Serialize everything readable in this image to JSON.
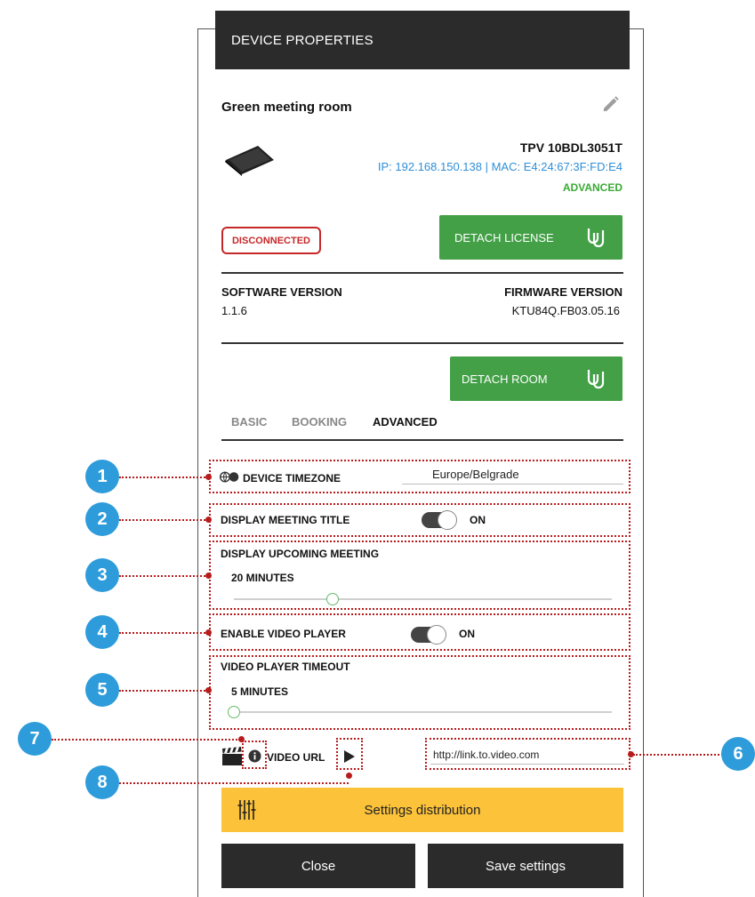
{
  "header": {
    "title": "DEVICE PROPERTIES"
  },
  "device": {
    "name": "Green meeting room",
    "model": "TPV 10BDL3051T",
    "ip_mac": "IP: 192.168.150.138 | MAC: E4:24:67:3F:FD:E4",
    "tier": "ADVANCED",
    "status": "DISCONNECTED"
  },
  "buttons": {
    "detach_license": "DETACH LICENSE",
    "detach_room": "DETACH ROOM",
    "settings_distribution": "Settings distribution",
    "close": "Close",
    "save": "Save settings"
  },
  "versions": {
    "software_label": "SOFTWARE VERSION",
    "software_value": "1.1.6",
    "firmware_label": "FIRMWARE VERSION",
    "firmware_value": "KTU84Q.FB03.05.16"
  },
  "tabs": [
    {
      "label": "BASIC",
      "active": false
    },
    {
      "label": "BOOKING",
      "active": false
    },
    {
      "label": "ADVANCED",
      "active": true
    }
  ],
  "settings": {
    "timezone": {
      "label": "DEVICE TIMEZONE",
      "value": "Europe/Belgrade"
    },
    "display_title": {
      "label": "DISPLAY MEETING TITLE",
      "state": "ON"
    },
    "upcoming": {
      "label": "DISPLAY UPCOMING MEETING",
      "value": "20 MINUTES",
      "level": 0.26
    },
    "video_player": {
      "label": "ENABLE VIDEO PLAYER",
      "state": "ON"
    },
    "video_timeout": {
      "label": "VIDEO PLAYER TIMEOUT",
      "value": "5 MINUTES",
      "level": 0.0
    },
    "video_url": {
      "label": "VIDEO URL",
      "value": "http://link.to.video.com"
    }
  },
  "callouts": [
    "1",
    "2",
    "3",
    "4",
    "5",
    "6",
    "7",
    "8"
  ],
  "colors": {
    "header": "#2b2b2b",
    "green": "#43a047",
    "red": "#c62828",
    "link_blue": "#2f8fd8",
    "yellow": "#fbc23a",
    "callout_blue": "#2e9cdb",
    "dotted_red": "#b71c1c"
  },
  "icons": {
    "edit": "pencil-icon",
    "device": "tablet-icon",
    "detach": "detach-icon",
    "timezone": "globe-icon",
    "video": "clapperboard-icon",
    "info": "info-icon",
    "play": "play-icon",
    "distribution": "sliders-icon"
  }
}
